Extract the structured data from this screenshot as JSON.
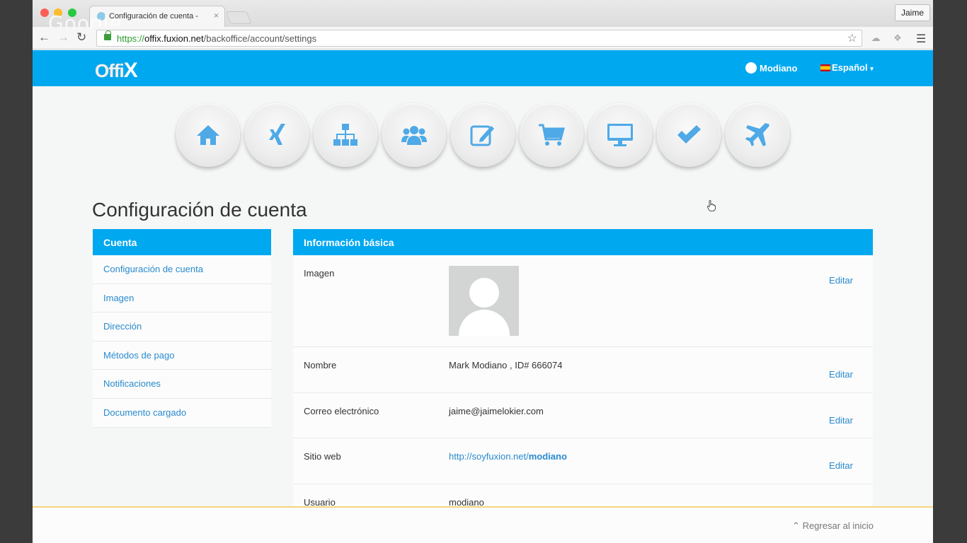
{
  "browser": {
    "tab_title": "Configuración de cuenta -",
    "tab_close": "×",
    "profile_name": "Jaime",
    "watermark": "Google",
    "url_scheme": "https://",
    "url_host": "offix.fuxion.net",
    "url_path": "/backoffice/account/settings"
  },
  "site": {
    "logo_part1": "Offi",
    "logo_part2": "X",
    "user_name": "Modiano",
    "language": "Español"
  },
  "nav_icons": [
    "home-icon",
    "xing-icon",
    "sitemap-icon",
    "users-icon",
    "edit-icon",
    "shopping-cart-icon",
    "desktop-icon",
    "check-icon",
    "plane-icon"
  ],
  "page": {
    "title": "Configuración de cuenta"
  },
  "sidebar": {
    "header": "Cuenta",
    "items": [
      {
        "label": "Configuración de cuenta"
      },
      {
        "label": "Imagen"
      },
      {
        "label": "Dirección"
      },
      {
        "label": "Métodos de pago"
      },
      {
        "label": "Notificaciones"
      },
      {
        "label": "Documento cargado"
      }
    ]
  },
  "info": {
    "header": "Información básica",
    "edit_label": "Editar",
    "rows": [
      {
        "label": "Imagen"
      },
      {
        "label": "Nombre",
        "value": "Mark Modiano , ID# 666074"
      },
      {
        "label": "Correo electrónico",
        "value": "jaime@jaimelokier.com"
      },
      {
        "label": "Sitio web",
        "value_prefix": "http://soyfuxion.net/",
        "value_bold": "modiano"
      },
      {
        "label": "Usuario",
        "value": "modiano"
      }
    ]
  },
  "footer": {
    "back_to_top": "Regresar al inicio"
  },
  "colors": {
    "brand_blue": "#00a8f0",
    "link_blue": "#2a8ad0",
    "icon_blue": "#4fa9e6"
  }
}
